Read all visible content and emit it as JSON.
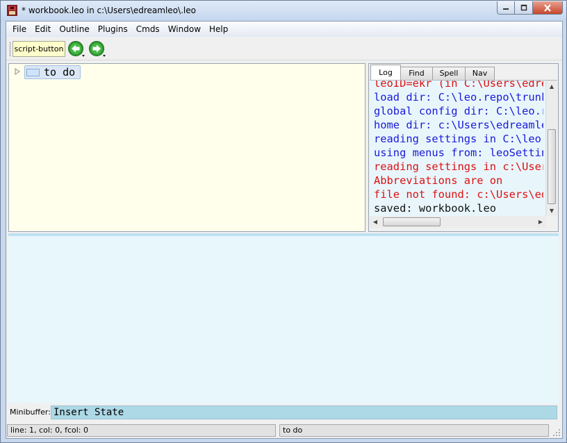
{
  "window": {
    "title": "* workbook.leo in c:\\Users\\edreamleo\\.leo",
    "icons": {
      "app": "leo-app-icon",
      "minimize": "minimize-icon",
      "maximize": "maximize-icon",
      "close": "close-icon"
    }
  },
  "menubar": {
    "items": [
      "File",
      "Edit",
      "Outline",
      "Plugins",
      "Cmds",
      "Window",
      "Help"
    ]
  },
  "toolbar": {
    "script_button": "script-button",
    "icons": {
      "back": "back-arrow-icon",
      "forward": "forward-arrow-icon"
    },
    "accent_color": "#2f9a2f"
  },
  "outline": {
    "background": "#ffffec",
    "nodes": [
      {
        "label": "to do",
        "selected": true,
        "expanded": false
      }
    ]
  },
  "log": {
    "tabs": [
      "Log",
      "Find",
      "Spell",
      "Nav"
    ],
    "active_tab": "Log",
    "lines": [
      {
        "text": "leoID=ekr (in C:\\Users\\edream",
        "color": "#dd1111"
      },
      {
        "text": "load dir: C:\\leo.repo\\trunk\\le",
        "color": "#1a1ad6"
      },
      {
        "text": "global config dir: C:\\leo.re",
        "color": "#1a1ad6"
      },
      {
        "text": "home dir: c:\\Users\\edreamleo",
        "color": "#1a1ad6"
      },
      {
        "text": "reading settings in C:\\leo.r",
        "color": "#1a1ad6"
      },
      {
        "text": "using menus from: leoSettings",
        "color": "#1a1ad6"
      },
      {
        "text": "reading settings in c:\\Users",
        "color": "#dd1111"
      },
      {
        "text": "Abbreviations are on",
        "color": "#dd1111"
      },
      {
        "text": "file not found: c:\\Users\\edr",
        "color": "#dd1111"
      },
      {
        "text": "saved: workbook.leo",
        "color": "#111111"
      }
    ]
  },
  "minibuffer": {
    "label": "Minibuffer:",
    "value": "Insert State"
  },
  "status": {
    "left": "line: 1, col: 0, fcol: 0",
    "right": "to do"
  }
}
